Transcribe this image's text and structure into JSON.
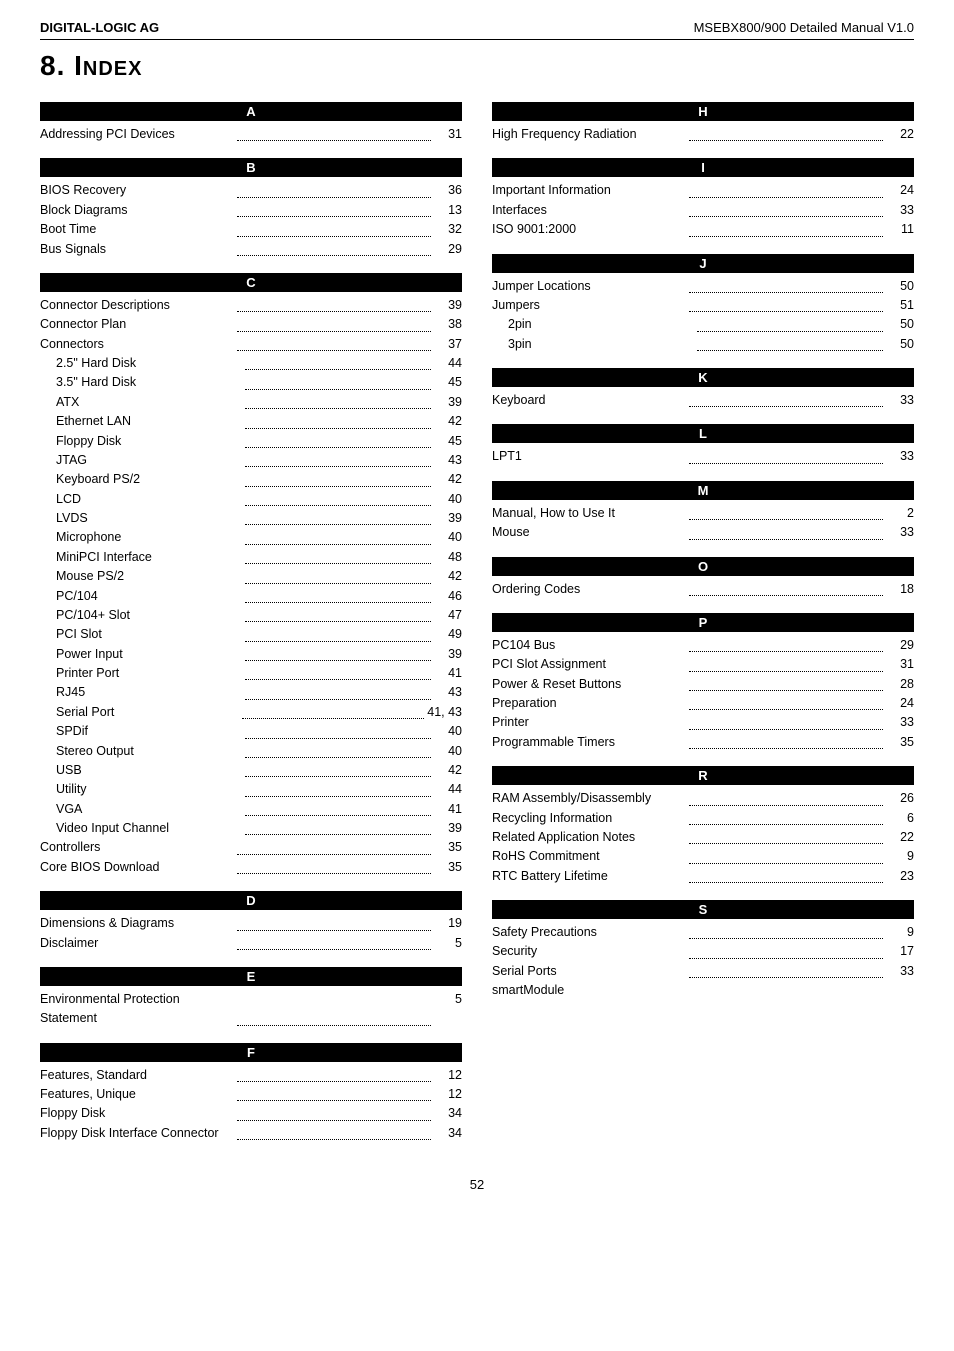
{
  "header": {
    "left": "DIGITAL-LOGIC AG",
    "right": "MSEBX800/900 Detailed Manual V1.0"
  },
  "title": "8.  Index",
  "left_column": {
    "sections": [
      {
        "letter": "A",
        "entries": [
          {
            "name": "Addressing PCI Devices",
            "page": "31",
            "indent": false
          }
        ]
      },
      {
        "letter": "B",
        "entries": [
          {
            "name": "BIOS Recovery",
            "page": "36",
            "indent": false
          },
          {
            "name": "Block Diagrams",
            "page": "13",
            "indent": false
          },
          {
            "name": "Boot Time",
            "page": "32",
            "indent": false
          },
          {
            "name": "Bus Signals",
            "page": "29",
            "indent": false
          }
        ]
      },
      {
        "letter": "C",
        "entries": [
          {
            "name": "Connector Descriptions",
            "page": "39",
            "indent": false
          },
          {
            "name": "Connector Plan",
            "page": "38",
            "indent": false
          },
          {
            "name": "Connectors",
            "page": "37",
            "indent": false
          },
          {
            "name": "2.5\" Hard Disk",
            "page": "44",
            "indent": true
          },
          {
            "name": "3.5\" Hard Disk",
            "page": "45",
            "indent": true
          },
          {
            "name": "ATX",
            "page": "39",
            "indent": true
          },
          {
            "name": "Ethernet LAN",
            "page": "42",
            "indent": true
          },
          {
            "name": "Floppy Disk",
            "page": "45",
            "indent": true
          },
          {
            "name": "JTAG",
            "page": "43",
            "indent": true
          },
          {
            "name": "Keyboard PS/2",
            "page": "42",
            "indent": true
          },
          {
            "name": "LCD",
            "page": "40",
            "indent": true
          },
          {
            "name": "LVDS",
            "page": "39",
            "indent": true
          },
          {
            "name": "Microphone",
            "page": "40",
            "indent": true
          },
          {
            "name": "MiniPCI Interface",
            "page": "48",
            "indent": true
          },
          {
            "name": "Mouse PS/2",
            "page": "42",
            "indent": true
          },
          {
            "name": "PC/104",
            "page": "46",
            "indent": true
          },
          {
            "name": "PC/104+ Slot",
            "page": "47",
            "indent": true
          },
          {
            "name": "PCI Slot",
            "page": "49",
            "indent": true
          },
          {
            "name": "Power Input",
            "page": "39",
            "indent": true
          },
          {
            "name": "Printer Port",
            "page": "41",
            "indent": true
          },
          {
            "name": "RJ45",
            "page": "43",
            "indent": true
          },
          {
            "name": "Serial Port",
            "page": "41, 43",
            "indent": true
          },
          {
            "name": "SPDif",
            "page": "40",
            "indent": true
          },
          {
            "name": "Stereo Output",
            "page": "40",
            "indent": true
          },
          {
            "name": "USB",
            "page": "42",
            "indent": true
          },
          {
            "name": "Utility",
            "page": "44",
            "indent": true
          },
          {
            "name": "VGA",
            "page": "41",
            "indent": true
          },
          {
            "name": "Video Input Channel",
            "page": "39",
            "indent": true
          },
          {
            "name": "Controllers",
            "page": "35",
            "indent": false
          },
          {
            "name": "Core BIOS Download",
            "page": "35",
            "indent": false
          }
        ]
      },
      {
        "letter": "D",
        "entries": [
          {
            "name": "Dimensions & Diagrams",
            "page": "19",
            "indent": false
          },
          {
            "name": "Disclaimer",
            "page": "5",
            "indent": false
          }
        ]
      },
      {
        "letter": "E",
        "entries": [
          {
            "name": "Environmental Protection Statement",
            "page": "5",
            "indent": false
          }
        ]
      },
      {
        "letter": "F",
        "entries": [
          {
            "name": "Features, Standard",
            "page": "12",
            "indent": false
          },
          {
            "name": "Features, Unique",
            "page": "12",
            "indent": false
          },
          {
            "name": "Floppy Disk",
            "page": "34",
            "indent": false
          },
          {
            "name": "Floppy Disk Interface Connector",
            "page": "34",
            "indent": false
          }
        ]
      }
    ]
  },
  "right_column": {
    "sections": [
      {
        "letter": "H",
        "entries": [
          {
            "name": "High Frequency Radiation",
            "page": "22",
            "indent": false
          }
        ]
      },
      {
        "letter": "I",
        "entries": [
          {
            "name": "Important Information",
            "page": "24",
            "indent": false
          },
          {
            "name": "Interfaces",
            "page": "33",
            "indent": false
          },
          {
            "name": "ISO 9001:2000",
            "page": "11",
            "indent": false
          }
        ]
      },
      {
        "letter": "J",
        "entries": [
          {
            "name": "Jumper Locations",
            "page": "50",
            "indent": false
          },
          {
            "name": "Jumpers",
            "page": "51",
            "indent": false
          },
          {
            "name": "2pin",
            "page": "50",
            "indent": true
          },
          {
            "name": "3pin",
            "page": "50",
            "indent": true
          }
        ]
      },
      {
        "letter": "K",
        "entries": [
          {
            "name": "Keyboard",
            "page": "33",
            "indent": false
          }
        ]
      },
      {
        "letter": "L",
        "entries": [
          {
            "name": "LPT1",
            "page": "33",
            "indent": false
          }
        ]
      },
      {
        "letter": "M",
        "entries": [
          {
            "name": "Manual, How to Use It",
            "page": "2",
            "indent": false
          },
          {
            "name": "Mouse",
            "page": "33",
            "indent": false
          }
        ]
      },
      {
        "letter": "O",
        "entries": [
          {
            "name": "Ordering Codes",
            "page": "18",
            "indent": false
          }
        ]
      },
      {
        "letter": "P",
        "entries": [
          {
            "name": "PC104 Bus",
            "page": "29",
            "indent": false
          },
          {
            "name": "PCI Slot Assignment",
            "page": "31",
            "indent": false
          },
          {
            "name": "Power & Reset Buttons",
            "page": "28",
            "indent": false
          },
          {
            "name": "Preparation",
            "page": "24",
            "indent": false
          },
          {
            "name": "Printer",
            "page": "33",
            "indent": false
          },
          {
            "name": "Programmable Timers",
            "page": "35",
            "indent": false
          }
        ]
      },
      {
        "letter": "R",
        "entries": [
          {
            "name": "RAM Assembly/Disassembly",
            "page": "26",
            "indent": false
          },
          {
            "name": "Recycling Information",
            "page": "6",
            "indent": false
          },
          {
            "name": "Related Application Notes",
            "page": "22",
            "indent": false
          },
          {
            "name": "RoHS Commitment",
            "page": "9",
            "indent": false
          },
          {
            "name": "RTC Battery Lifetime",
            "page": "23",
            "indent": false
          }
        ]
      },
      {
        "letter": "S",
        "entries": [
          {
            "name": "Safety Precautions",
            "page": "9",
            "indent": false
          },
          {
            "name": "Security",
            "page": "17",
            "indent": false
          },
          {
            "name": "Serial Ports",
            "page": "33",
            "indent": false
          },
          {
            "name": "smartModule",
            "page": "",
            "indent": false
          }
        ]
      }
    ]
  },
  "footer": {
    "page_number": "52"
  }
}
